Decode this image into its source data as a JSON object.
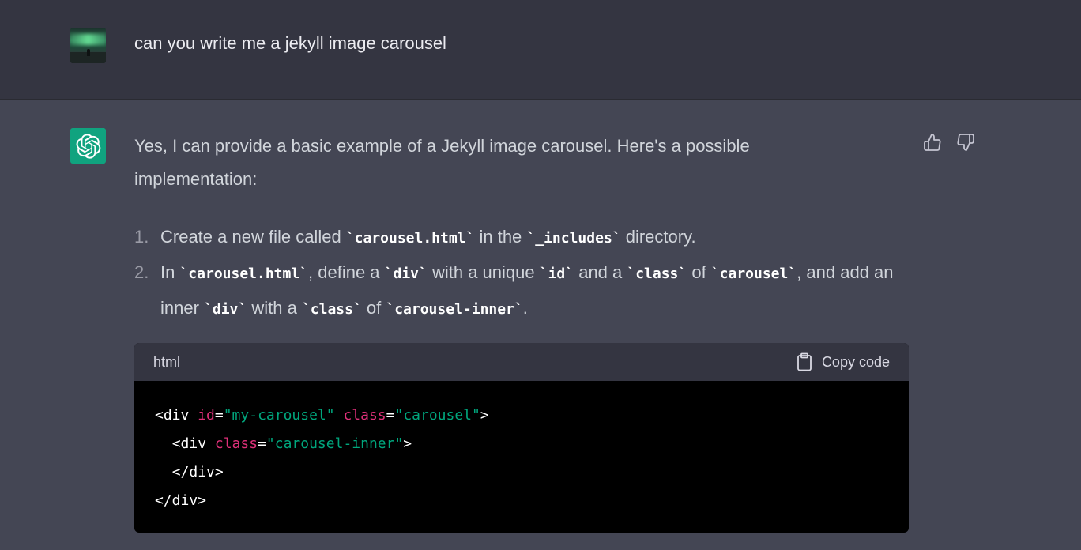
{
  "user_message": {
    "avatar": "user-photo-avatar",
    "text": "can you write me a jekyll image carousel"
  },
  "assistant_message": {
    "avatar_icon": "openai-logo-icon",
    "intro_line1": "Yes, I can provide a basic example of a Jekyll image carousel. Here's a possible",
    "intro_line2": "implementation:",
    "steps": [
      {
        "num": "1.",
        "parts": {
          "t1": "Create a new file called ",
          "c1": "`carousel.html`",
          "t2": " in the ",
          "c2": "`_includes`",
          "t3": " directory."
        }
      },
      {
        "num": "2.",
        "parts": {
          "t1": "In ",
          "c1": "`carousel.html`",
          "t2": ", define a ",
          "c2": "`div`",
          "t3": " with a unique ",
          "c3": "`id`",
          "t4": " and a ",
          "c4": "`class`",
          "t5": " of ",
          "c5": "`carousel`",
          "t6": ", and add an inner ",
          "c6": "`div`",
          "t7": " with a ",
          "c7": "`class`",
          "t8": " of ",
          "c8": "`carousel-inner`",
          "t9": "."
        }
      }
    ],
    "feedback": {
      "thumbs_up_icon": "thumbs-up-icon",
      "thumbs_down_icon": "thumbs-down-icon"
    }
  },
  "code_block": {
    "language": "html",
    "copy_label": "Copy code",
    "copy_icon": "clipboard-icon",
    "lines": [
      {
        "indent": "",
        "open": "<div ",
        "a1": "id",
        "eq1": "=",
        "v1": "\"my-carousel\"",
        "sp": " ",
        "a2": "class",
        "eq2": "=",
        "v2": "\"carousel\"",
        "close": ">"
      },
      {
        "indent": "  ",
        "open": "<div ",
        "a1": "class",
        "eq1": "=",
        "v1": "\"carousel-inner\"",
        "close": ">"
      },
      {
        "indent": "  ",
        "text": "</div>"
      },
      {
        "indent": "",
        "text": "</div>"
      }
    ]
  },
  "colors": {
    "page_bg": "#444654",
    "user_row_bg": "#343541",
    "code_header_bg": "#343541",
    "code_bg": "#000000",
    "accent_green": "#10a37f",
    "attr_color": "#df3079",
    "string_color": "#00a67d"
  }
}
